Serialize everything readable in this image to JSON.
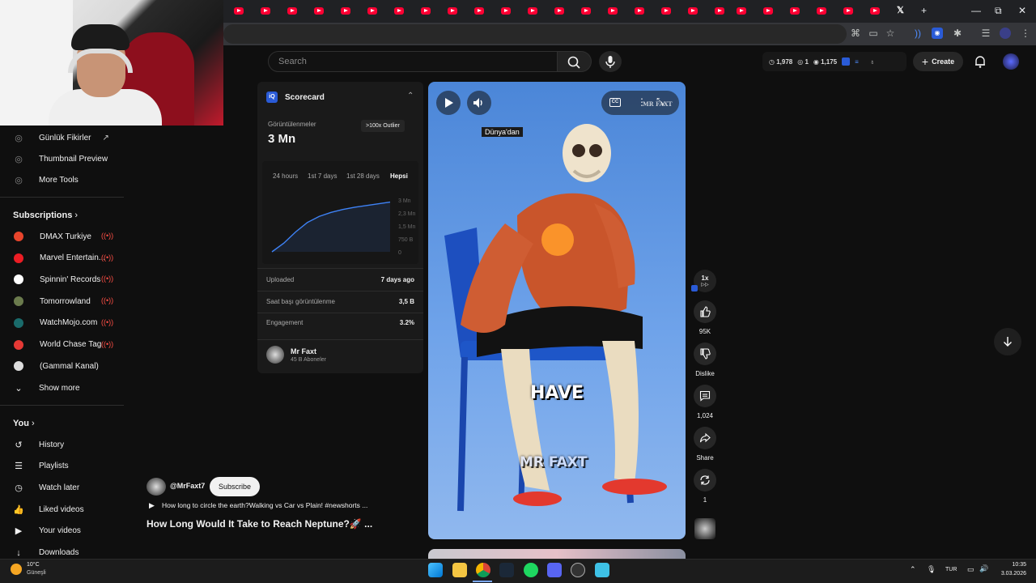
{
  "browser": {
    "tab_close": "×",
    "new_tab": "+",
    "win_min": "—",
    "win_restore": "⧉",
    "win_close": "✕"
  },
  "header": {
    "search_placeholder": "Search",
    "stats": {
      "views": "1,978",
      "likes": "1",
      "watch": "1,175"
    },
    "create_label": "Create"
  },
  "sidebar": {
    "tools": [
      {
        "label": "Günlük Fikirler",
        "external": "↗"
      },
      {
        "label": "Thumbnail Preview"
      },
      {
        "label": "More Tools"
      }
    ],
    "subscriptions_title": "Subscriptions",
    "subscriptions": [
      {
        "label": "DMAX Turkiye",
        "color": "#e8452c"
      },
      {
        "label": "Marvel Entertain...",
        "color": "#ec1d24"
      },
      {
        "label": "Spinnin' Records",
        "color": "#ffffff"
      },
      {
        "label": "Tomorrowland",
        "color": "#6b7b4d"
      },
      {
        "label": "WatchMojo.com",
        "color": "#1a6b6b"
      },
      {
        "label": "World Chase Tag",
        "color": "#e53935"
      },
      {
        "label": "(Gammal Kanal)",
        "color": "#dddddd"
      }
    ],
    "show_more": "Show more",
    "you_title": "You",
    "you_items": [
      {
        "label": "History",
        "icon": "history-icon"
      },
      {
        "label": "Playlists",
        "icon": "playlists-icon"
      },
      {
        "label": "Watch later",
        "icon": "clock-icon"
      },
      {
        "label": "Liked videos",
        "icon": "thumbs-up-icon"
      },
      {
        "label": "Your videos",
        "icon": "play-square-icon"
      },
      {
        "label": "Downloads",
        "icon": "download-icon"
      }
    ]
  },
  "scorecard": {
    "title": "Scorecard",
    "views_label": "Görüntülenmeler",
    "views_value": "3 Mn",
    "outlier_badge": ">100x Outlier",
    "tabs": [
      "24 hours",
      "1st 7 days",
      "1st 28 days",
      "Hepsi"
    ],
    "active_tab": "Hepsi",
    "axis_ticks": [
      "3 Mn",
      "2,3 Mn",
      "1,5 Mn",
      "750 B",
      "0"
    ],
    "rows": [
      {
        "label": "Uploaded",
        "value": "7 days ago"
      },
      {
        "label": "Saat başı görüntülenme",
        "value": "3,5 B"
      },
      {
        "label": "Engagement",
        "value": "3.2%"
      }
    ],
    "channel_name": "Mr Faxt",
    "channel_subs": "45 B Aboneler"
  },
  "chart_data": {
    "type": "line",
    "yticks": [
      "3 Mn",
      "2,3 Mn",
      "1,5 Mn",
      "750 B",
      "0"
    ],
    "ylim": [
      0,
      3000000
    ],
    "x": [
      0,
      1,
      2,
      3,
      4,
      5,
      6,
      7,
      8,
      9,
      10
    ],
    "values": [
      0,
      500000,
      1150000,
      1700000,
      2050000,
      2280000,
      2450000,
      2580000,
      2680000,
      2780000,
      2880000
    ]
  },
  "video": {
    "tag": "Dünya'dan",
    "caption_have": "HAVE",
    "caption_watermark": "MR FAXT",
    "corner_watermark": "MR FAXT",
    "cc_label": "CC"
  },
  "meta": {
    "channel_handle": "@MrFaxt7",
    "subscribe_label": "Subscribe",
    "related_title": "How long to circle the earth?Walking vs Car vs Plain! #newshorts ...",
    "video_title": "How Long Would It Take to Reach Neptune?🚀 ..."
  },
  "actions": {
    "speed": "1x",
    "likes": "95K",
    "dislike": "Dislike",
    "comments": "1,024",
    "share": "Share",
    "remix": "1"
  },
  "taskbar": {
    "weather_temp": "10°C",
    "weather_desc": "Güneşli",
    "lang": "TUR",
    "time": "10:35",
    "date": "3.03.2026"
  }
}
